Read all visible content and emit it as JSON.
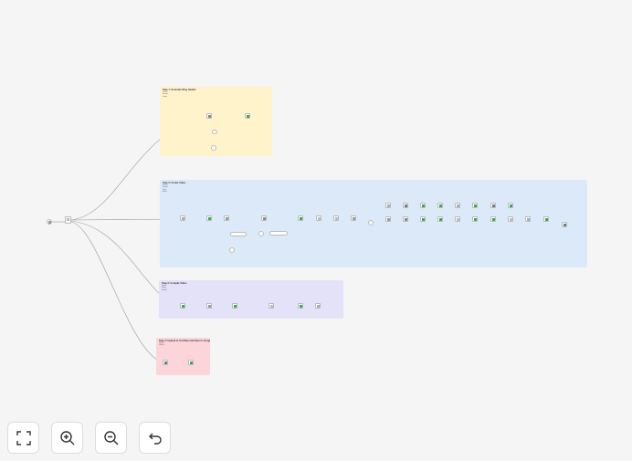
{
  "sticky_notes": [
    {
      "id": "step1",
      "title": "Step 1: Generate Blog Header",
      "lines": [
        "Details",
        "Prompt",
        "Image"
      ],
      "color": "#fff3cc"
    },
    {
      "id": "step2",
      "title": "Step 2: Create Video",
      "lines": [
        "Details",
        "Prompt",
        "Clips",
        "Audio"
      ],
      "color": "#dce9f8"
    },
    {
      "id": "step3",
      "title": "Step 3: Compile Video",
      "lines": [
        "Details",
        "Merge",
        "Upload"
      ],
      "color": "#e4e2f8"
    },
    {
      "id": "step4",
      "title": "Step 4: Upload to YouTube and Save to Google Drive",
      "lines": [
        "Details",
        "Upload"
      ],
      "color": "#fbd5da"
    }
  ],
  "controls": {
    "fit_view": "fit-view",
    "zoom_in": "zoom-in",
    "zoom_out": "zoom-out",
    "reset": "reset-zoom"
  }
}
